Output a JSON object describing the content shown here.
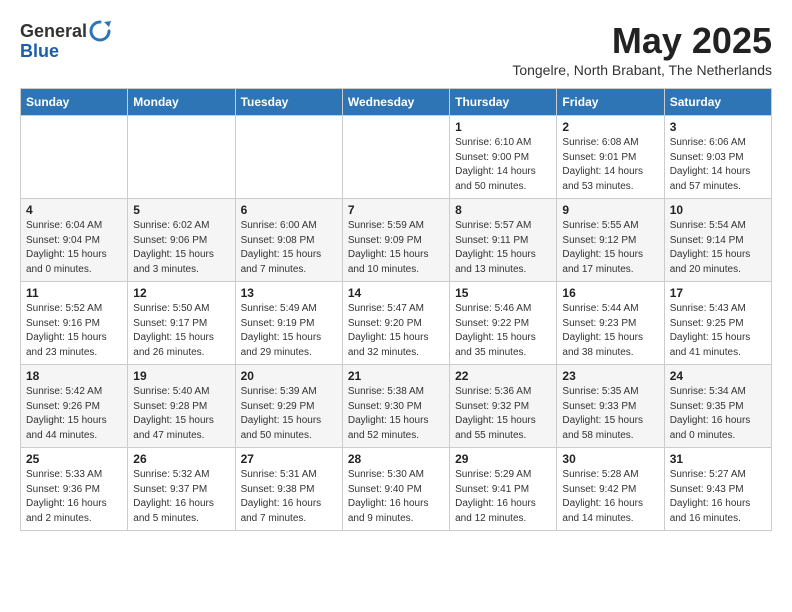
{
  "header": {
    "logo_general": "General",
    "logo_blue": "Blue",
    "month_title": "May 2025",
    "subtitle": "Tongelre, North Brabant, The Netherlands"
  },
  "days_of_week": [
    "Sunday",
    "Monday",
    "Tuesday",
    "Wednesday",
    "Thursday",
    "Friday",
    "Saturday"
  ],
  "weeks": [
    [
      {
        "day": "",
        "info": ""
      },
      {
        "day": "",
        "info": ""
      },
      {
        "day": "",
        "info": ""
      },
      {
        "day": "",
        "info": ""
      },
      {
        "day": "1",
        "info": "Sunrise: 6:10 AM\nSunset: 9:00 PM\nDaylight: 14 hours\nand 50 minutes."
      },
      {
        "day": "2",
        "info": "Sunrise: 6:08 AM\nSunset: 9:01 PM\nDaylight: 14 hours\nand 53 minutes."
      },
      {
        "day": "3",
        "info": "Sunrise: 6:06 AM\nSunset: 9:03 PM\nDaylight: 14 hours\nand 57 minutes."
      }
    ],
    [
      {
        "day": "4",
        "info": "Sunrise: 6:04 AM\nSunset: 9:04 PM\nDaylight: 15 hours\nand 0 minutes."
      },
      {
        "day": "5",
        "info": "Sunrise: 6:02 AM\nSunset: 9:06 PM\nDaylight: 15 hours\nand 3 minutes."
      },
      {
        "day": "6",
        "info": "Sunrise: 6:00 AM\nSunset: 9:08 PM\nDaylight: 15 hours\nand 7 minutes."
      },
      {
        "day": "7",
        "info": "Sunrise: 5:59 AM\nSunset: 9:09 PM\nDaylight: 15 hours\nand 10 minutes."
      },
      {
        "day": "8",
        "info": "Sunrise: 5:57 AM\nSunset: 9:11 PM\nDaylight: 15 hours\nand 13 minutes."
      },
      {
        "day": "9",
        "info": "Sunrise: 5:55 AM\nSunset: 9:12 PM\nDaylight: 15 hours\nand 17 minutes."
      },
      {
        "day": "10",
        "info": "Sunrise: 5:54 AM\nSunset: 9:14 PM\nDaylight: 15 hours\nand 20 minutes."
      }
    ],
    [
      {
        "day": "11",
        "info": "Sunrise: 5:52 AM\nSunset: 9:16 PM\nDaylight: 15 hours\nand 23 minutes."
      },
      {
        "day": "12",
        "info": "Sunrise: 5:50 AM\nSunset: 9:17 PM\nDaylight: 15 hours\nand 26 minutes."
      },
      {
        "day": "13",
        "info": "Sunrise: 5:49 AM\nSunset: 9:19 PM\nDaylight: 15 hours\nand 29 minutes."
      },
      {
        "day": "14",
        "info": "Sunrise: 5:47 AM\nSunset: 9:20 PM\nDaylight: 15 hours\nand 32 minutes."
      },
      {
        "day": "15",
        "info": "Sunrise: 5:46 AM\nSunset: 9:22 PM\nDaylight: 15 hours\nand 35 minutes."
      },
      {
        "day": "16",
        "info": "Sunrise: 5:44 AM\nSunset: 9:23 PM\nDaylight: 15 hours\nand 38 minutes."
      },
      {
        "day": "17",
        "info": "Sunrise: 5:43 AM\nSunset: 9:25 PM\nDaylight: 15 hours\nand 41 minutes."
      }
    ],
    [
      {
        "day": "18",
        "info": "Sunrise: 5:42 AM\nSunset: 9:26 PM\nDaylight: 15 hours\nand 44 minutes."
      },
      {
        "day": "19",
        "info": "Sunrise: 5:40 AM\nSunset: 9:28 PM\nDaylight: 15 hours\nand 47 minutes."
      },
      {
        "day": "20",
        "info": "Sunrise: 5:39 AM\nSunset: 9:29 PM\nDaylight: 15 hours\nand 50 minutes."
      },
      {
        "day": "21",
        "info": "Sunrise: 5:38 AM\nSunset: 9:30 PM\nDaylight: 15 hours\nand 52 minutes."
      },
      {
        "day": "22",
        "info": "Sunrise: 5:36 AM\nSunset: 9:32 PM\nDaylight: 15 hours\nand 55 minutes."
      },
      {
        "day": "23",
        "info": "Sunrise: 5:35 AM\nSunset: 9:33 PM\nDaylight: 15 hours\nand 58 minutes."
      },
      {
        "day": "24",
        "info": "Sunrise: 5:34 AM\nSunset: 9:35 PM\nDaylight: 16 hours\nand 0 minutes."
      }
    ],
    [
      {
        "day": "25",
        "info": "Sunrise: 5:33 AM\nSunset: 9:36 PM\nDaylight: 16 hours\nand 2 minutes."
      },
      {
        "day": "26",
        "info": "Sunrise: 5:32 AM\nSunset: 9:37 PM\nDaylight: 16 hours\nand 5 minutes."
      },
      {
        "day": "27",
        "info": "Sunrise: 5:31 AM\nSunset: 9:38 PM\nDaylight: 16 hours\nand 7 minutes."
      },
      {
        "day": "28",
        "info": "Sunrise: 5:30 AM\nSunset: 9:40 PM\nDaylight: 16 hours\nand 9 minutes."
      },
      {
        "day": "29",
        "info": "Sunrise: 5:29 AM\nSunset: 9:41 PM\nDaylight: 16 hours\nand 12 minutes."
      },
      {
        "day": "30",
        "info": "Sunrise: 5:28 AM\nSunset: 9:42 PM\nDaylight: 16 hours\nand 14 minutes."
      },
      {
        "day": "31",
        "info": "Sunrise: 5:27 AM\nSunset: 9:43 PM\nDaylight: 16 hours\nand 16 minutes."
      }
    ]
  ]
}
